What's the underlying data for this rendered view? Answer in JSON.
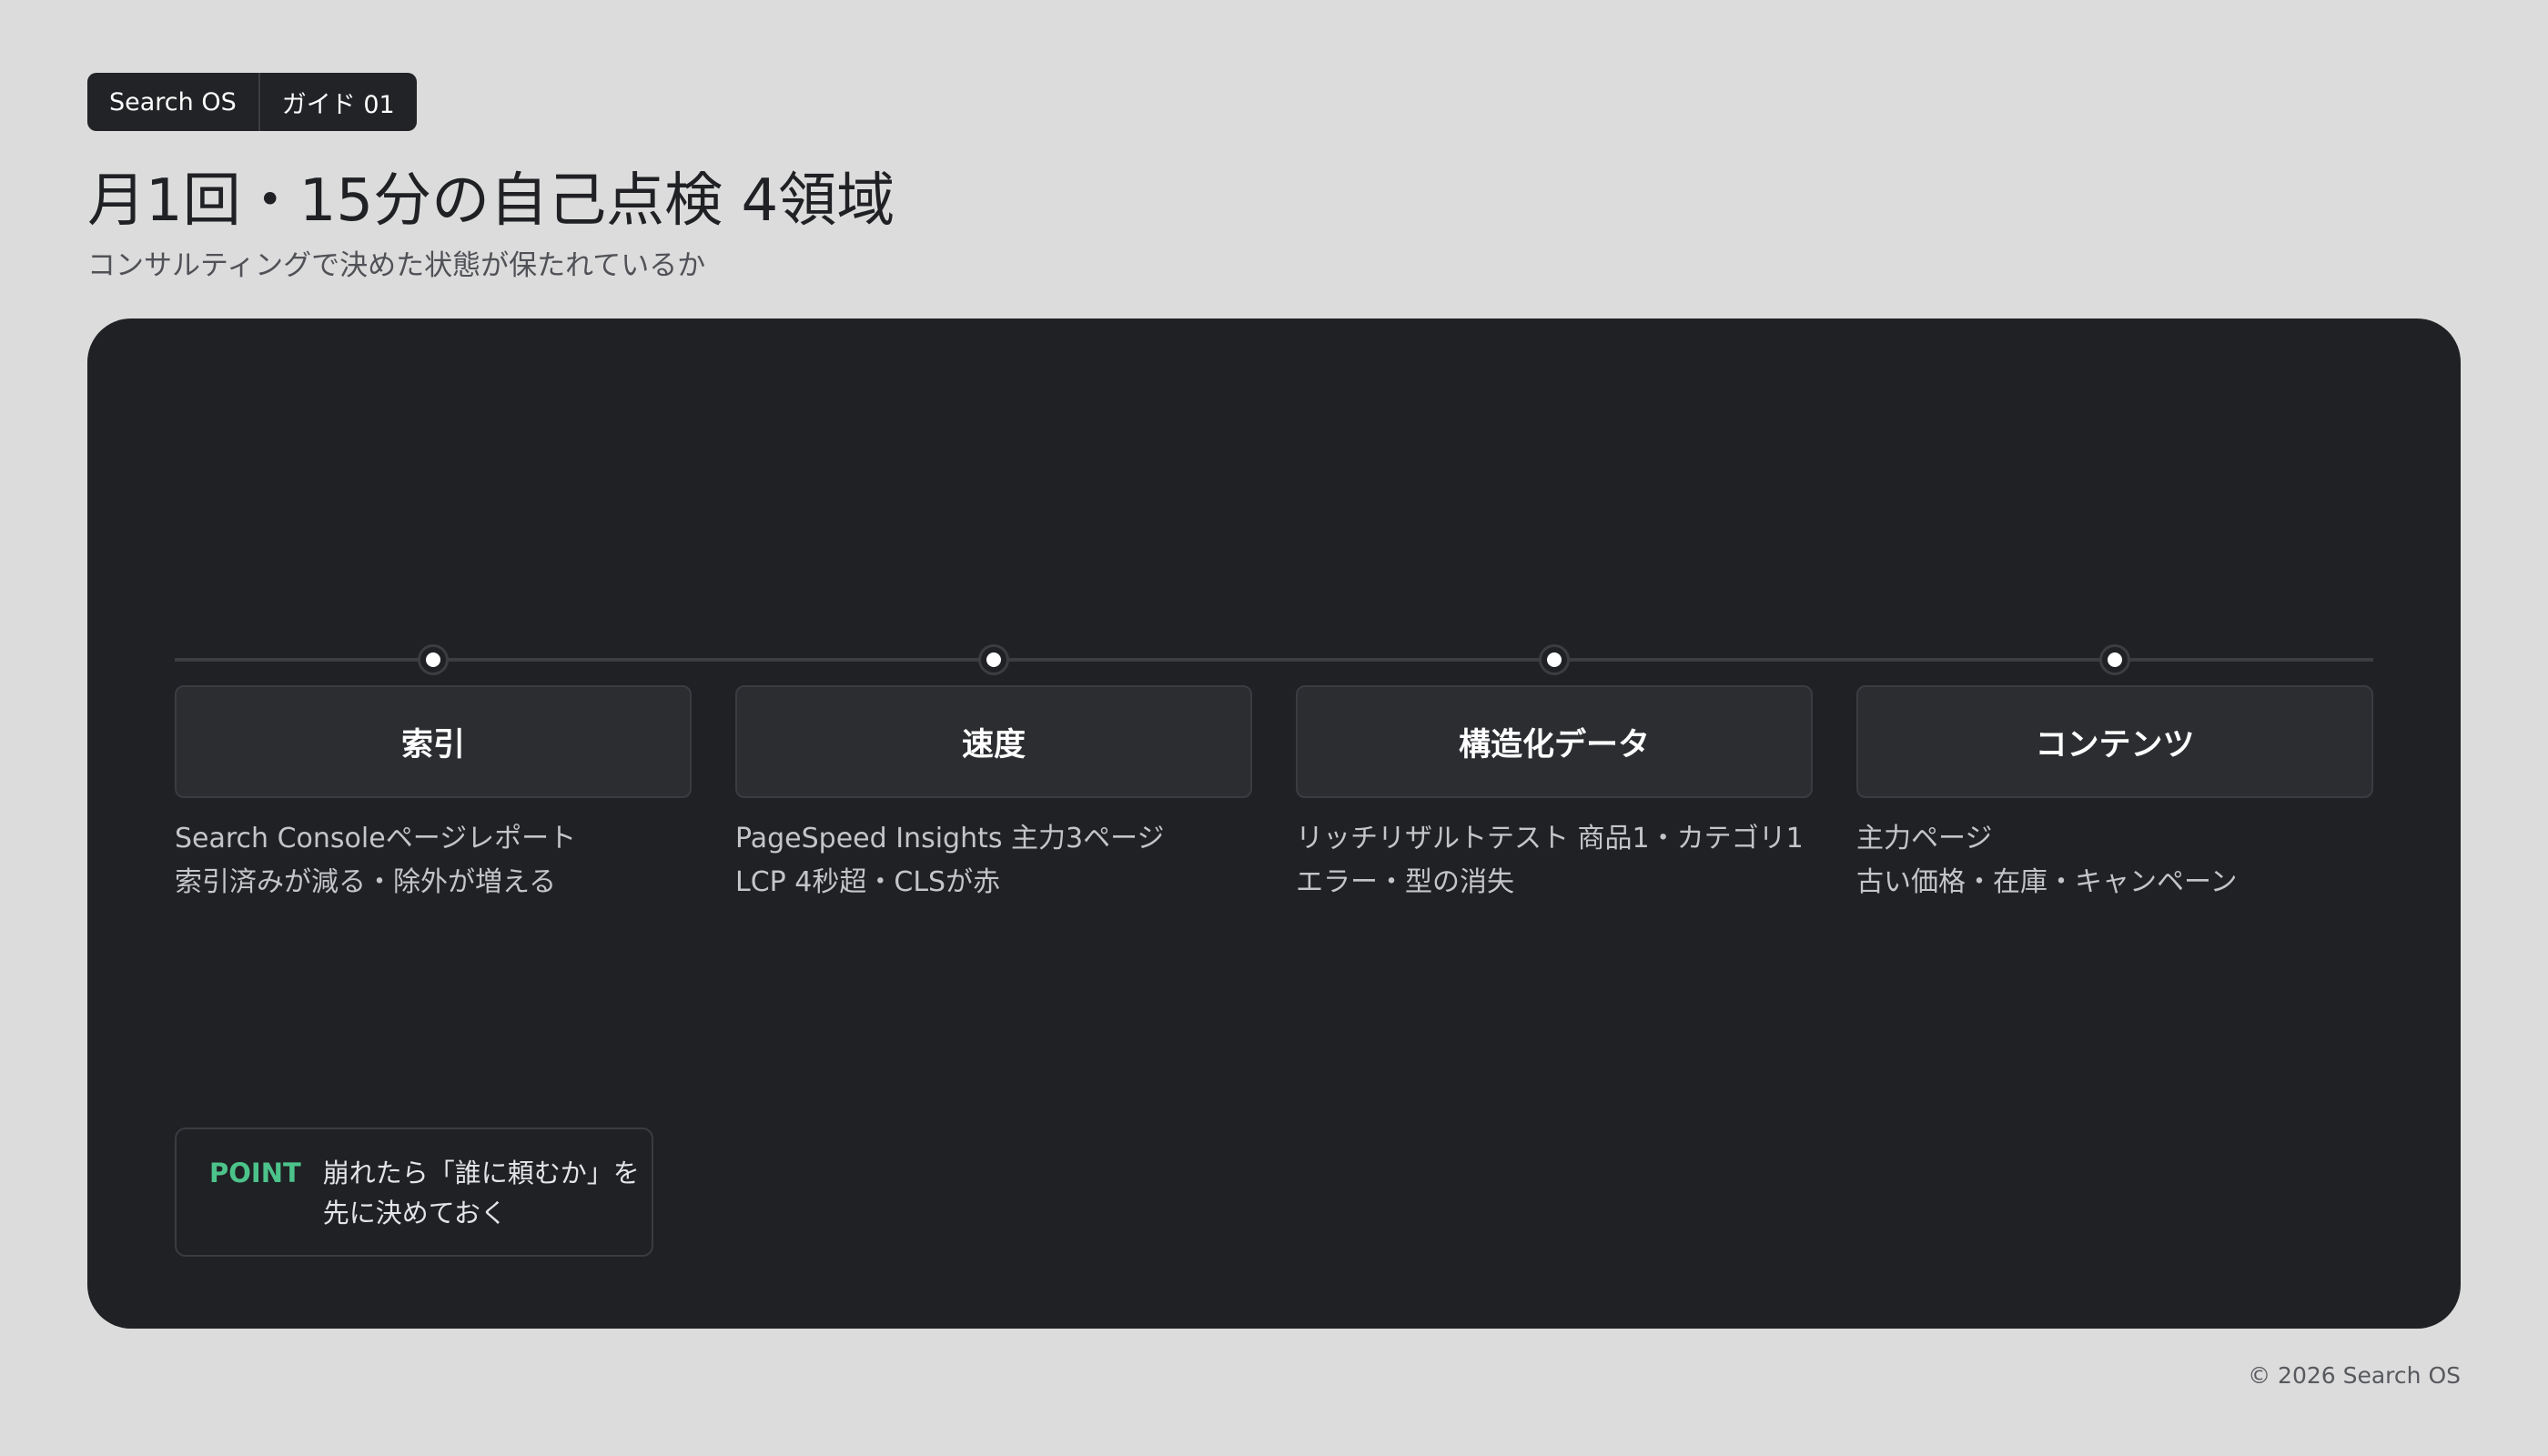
{
  "header": {
    "badge": {
      "brand": "Search OS",
      "guide": "ガイド 01"
    },
    "title": "月1回・15分の自己点検 4領域",
    "subtitle": "コンサルティングで決めた状態が保たれているか"
  },
  "diagram": {
    "steps": [
      {
        "title": "索引",
        "lines": [
          "Search Consoleページレポート",
          "索引済みが減る・除外が増える"
        ]
      },
      {
        "title": "速度",
        "lines": [
          "PageSpeed Insights 主力3ページ",
          "LCP 4秒超・CLSが赤"
        ]
      },
      {
        "title": "構造化データ",
        "lines": [
          "リッチリザルトテスト 商品1・カテゴリ1",
          "エラー・型の消失"
        ]
      },
      {
        "title": "コンテンツ",
        "lines": [
          "主力ページ",
          "古い価格・在庫・キャンペーン"
        ]
      }
    ],
    "point": {
      "label": "POINT",
      "lines": [
        "崩れたら「誰に頼むか」を",
        "先に決めておく"
      ]
    }
  },
  "footer": {
    "copyright": "© 2026 Search OS"
  },
  "colors": {
    "background": "#dcdcdc",
    "panel": "#202124",
    "card": "#2b2d31",
    "accent": "#4cc38a"
  }
}
